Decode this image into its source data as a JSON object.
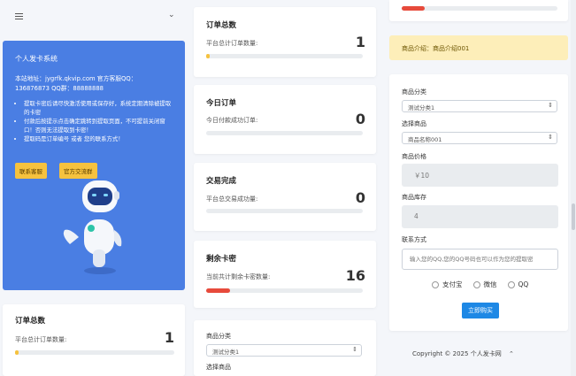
{
  "sidebar": {
    "menu_icon": "hamburger-icon",
    "toggle_icon": "chevron-down-icon"
  },
  "notice": {
    "title": "个人发卡系统",
    "site_line1": "本站地址：jygrfk.qkvip.com     官方客服QQ：",
    "site_line2": "136876873    QQ群：88888888",
    "items": [
      "提取卡密后请尽快激活使用或保存好，系统定期清除被提取的卡密",
      "付款后按提示点击确定跳转到提取页面，不可提前关闭窗口！否则无法提取到卡密！",
      "提取码是订单编号 或者 您的联系方式！"
    ],
    "btn_contact": "联系客服",
    "btn_group": "官方交流群",
    "bg_color": "#4a7ee3",
    "accent_button": "#f6c23e"
  },
  "left_stat": {
    "title": "订单总数",
    "label": "平台总计订单数量:",
    "value": "1",
    "progress": 0.02
  },
  "stats": [
    {
      "title": "订单总数",
      "label": "平台总计订单数量:",
      "value": "1",
      "progress": 0.02,
      "color": "#f6c23e"
    },
    {
      "title": "今日订单",
      "label": "今日付款成功订单:",
      "value": "0",
      "progress": 0,
      "color": "#4a7ee3"
    },
    {
      "title": "交易完成",
      "label": "平台总交易成功量:",
      "value": "0",
      "progress": 0,
      "color": "#1cc88a"
    },
    {
      "title": "剩余卡密",
      "label": "当前共计剩余卡密数量:",
      "value": "16",
      "progress": 0.15,
      "color": "#e74a3b"
    }
  ],
  "mid_form": {
    "category_label": "商品分类",
    "category_value": "测试分类1",
    "product_label": "选择商品"
  },
  "right": {
    "top_progress": 0.15,
    "intro": "商品介绍：商品介绍001",
    "category_label": "商品分类",
    "category_value": "测试分类1",
    "product_label": "选择商品",
    "product_value": "商品名称001",
    "price_label": "商品价格",
    "price_value": "￥10",
    "stock_label": "商品库存",
    "stock_value": "4",
    "contact_label": "联系方式",
    "contact_placeholder": "输入您的QQ,您的QQ号码也可以作为您的提取密",
    "pay_options": [
      "支付宝",
      "微信",
      "QQ"
    ],
    "buy_button": "立即购买",
    "intro_bg": "#fdeeb9"
  },
  "footer": {
    "copyright": "Copyright © 2025 个人发卡网"
  }
}
